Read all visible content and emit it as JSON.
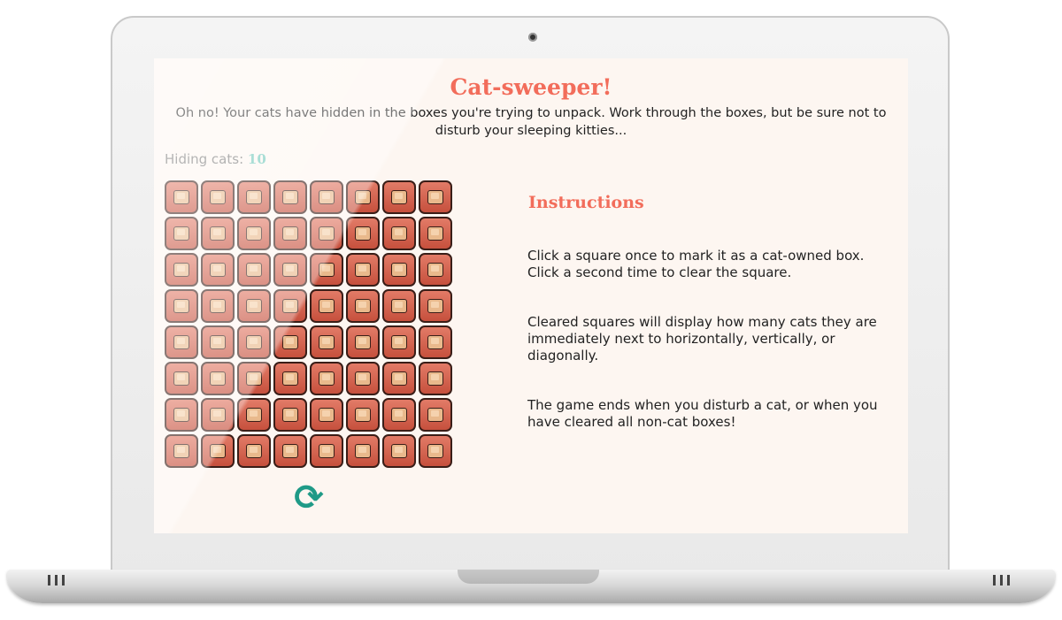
{
  "app": {
    "title": "Cat-sweeper!",
    "intro": "Oh no! Your cats have hidden in the boxes you're trying to unpack. Work through the boxes, but be sure not to disturb your sleeping kitties..."
  },
  "counter": {
    "label": "Hiding cats:",
    "value": "10"
  },
  "board": {
    "rows": 8,
    "cols": 8,
    "cell_icon": "box-icon"
  },
  "reset": {
    "icon": "refresh-icon",
    "glyph": "⟳"
  },
  "instructions": {
    "title": "Instructions",
    "paragraphs": [
      "Click a square once to mark it as a cat-owned box. Click a second time to clear the square.",
      "Cleared squares will display how many cats they are immediately next to horizontally, vertically, or diagonally.",
      "The game ends when you disturb a cat, or when you have cleared all non-cat boxes!"
    ]
  },
  "colors": {
    "accent": "#f26d5b",
    "counter": "#6cc7b9",
    "reset": "#1f9a87",
    "tile": "#d8644f",
    "background": "#fdf6f1"
  }
}
